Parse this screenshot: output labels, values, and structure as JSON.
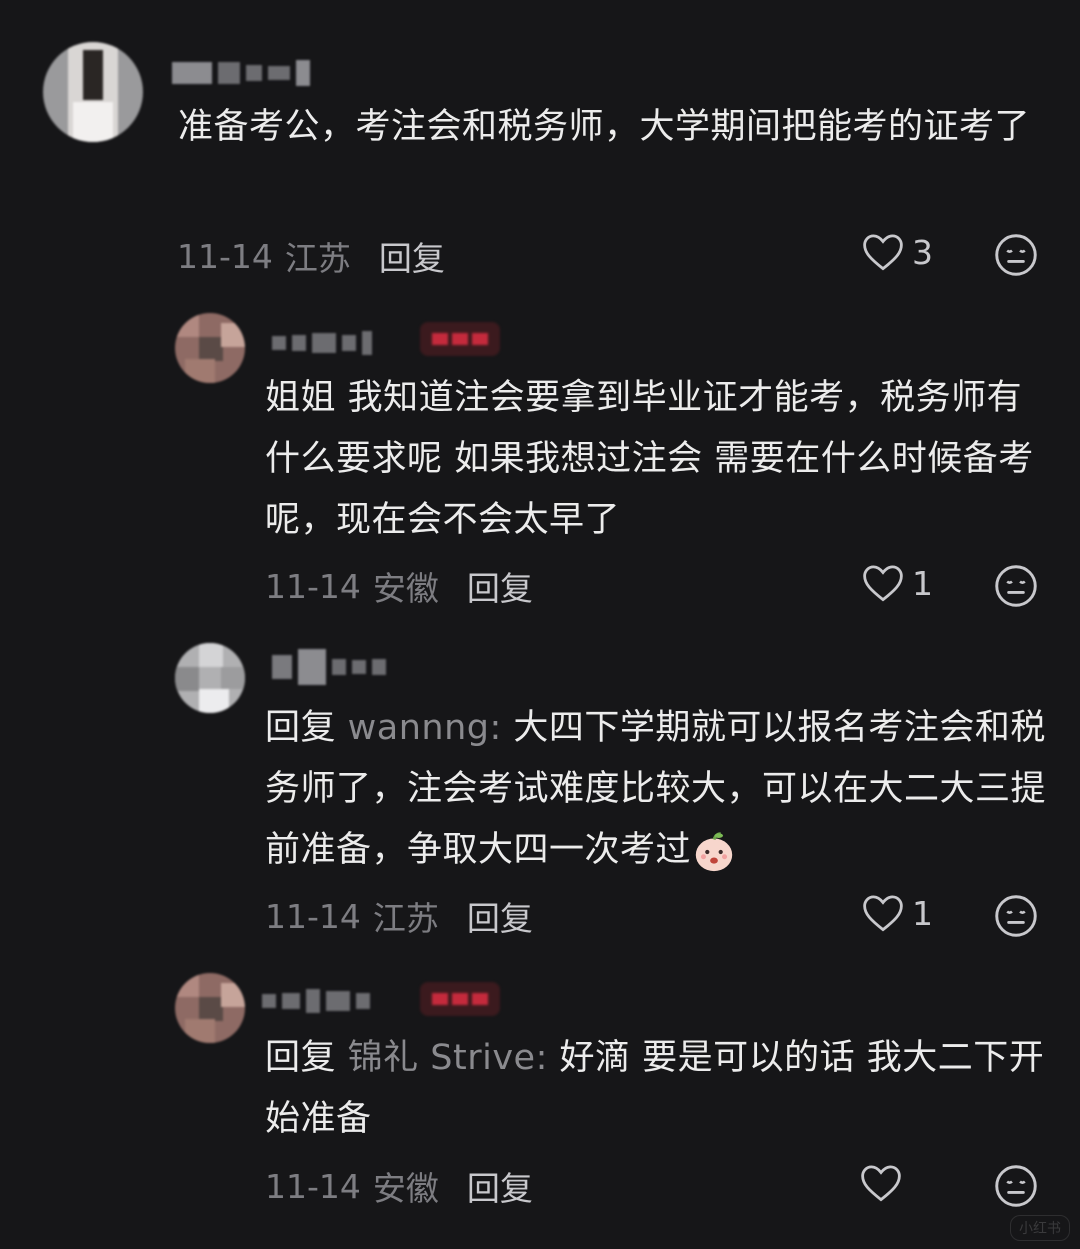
{
  "comments": [
    {
      "text": "准备考公，考注会和税务师，大学期间把能考的证考了",
      "date": "11-14",
      "location": "江苏",
      "reply_label": "回复",
      "likes": "3"
    },
    {
      "text": "姐姐 我知道注会要拿到毕业证才能考，税务师有什么要求呢 如果我想过注会 需要在什么时候备考呢，现在会不会太早了",
      "date": "11-14",
      "location": "安徽",
      "reply_label": "回复",
      "likes": "1"
    },
    {
      "prefix": "回复 ",
      "mention": "wannng:",
      "text": " 大四下学期就可以报名考注会和税务师了，注会考试难度比较大，可以在大二大三提前准备，争取大四一次考过",
      "date": "11-14",
      "location": "江苏",
      "reply_label": "回复",
      "likes": "1"
    },
    {
      "prefix": "回复 ",
      "mention": "锦礼 Strive:",
      "text": " 好滴 要是可以的话 我大二下开始准备",
      "date": "11-14",
      "location": "安徽",
      "reply_label": "回复",
      "likes": ""
    }
  ],
  "watermark": "小红书",
  "colors": {
    "background": "#161618",
    "text": "#ececec",
    "meta": "#7d7d82",
    "mention": "#8a8a8e"
  },
  "icons": [
    "heart-icon",
    "neutral-face-icon",
    "peach-emoji"
  ]
}
